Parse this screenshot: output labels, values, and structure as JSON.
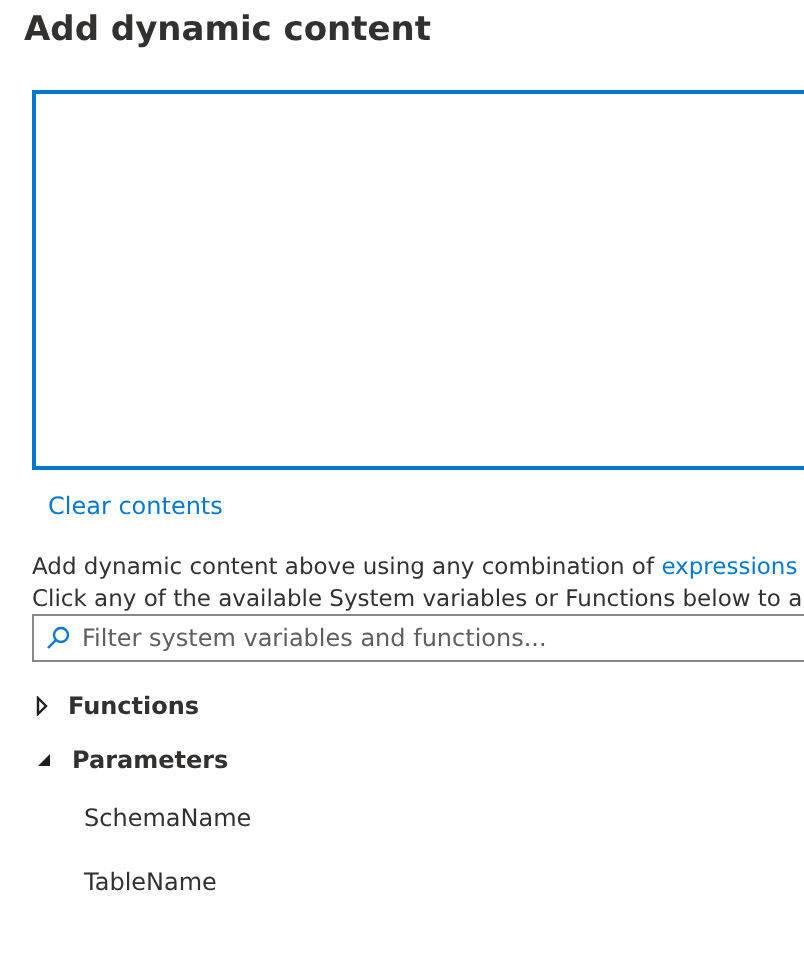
{
  "title": "Add dynamic content",
  "clear_link": "Clear contents",
  "help_lines": [
    {
      "text": "Add dynamic content above using any combination of ",
      "link": "expressions"
    },
    {
      "text": "Click any of the available System variables or Functions below to a"
    }
  ],
  "filter": {
    "placeholder": "Filter system variables and functions..."
  },
  "tree": [
    {
      "label": "Functions",
      "expanded": false
    },
    {
      "label": "Parameters",
      "expanded": true,
      "children": [
        {
          "label": "SchemaName"
        },
        {
          "label": "TableName"
        }
      ]
    }
  ]
}
